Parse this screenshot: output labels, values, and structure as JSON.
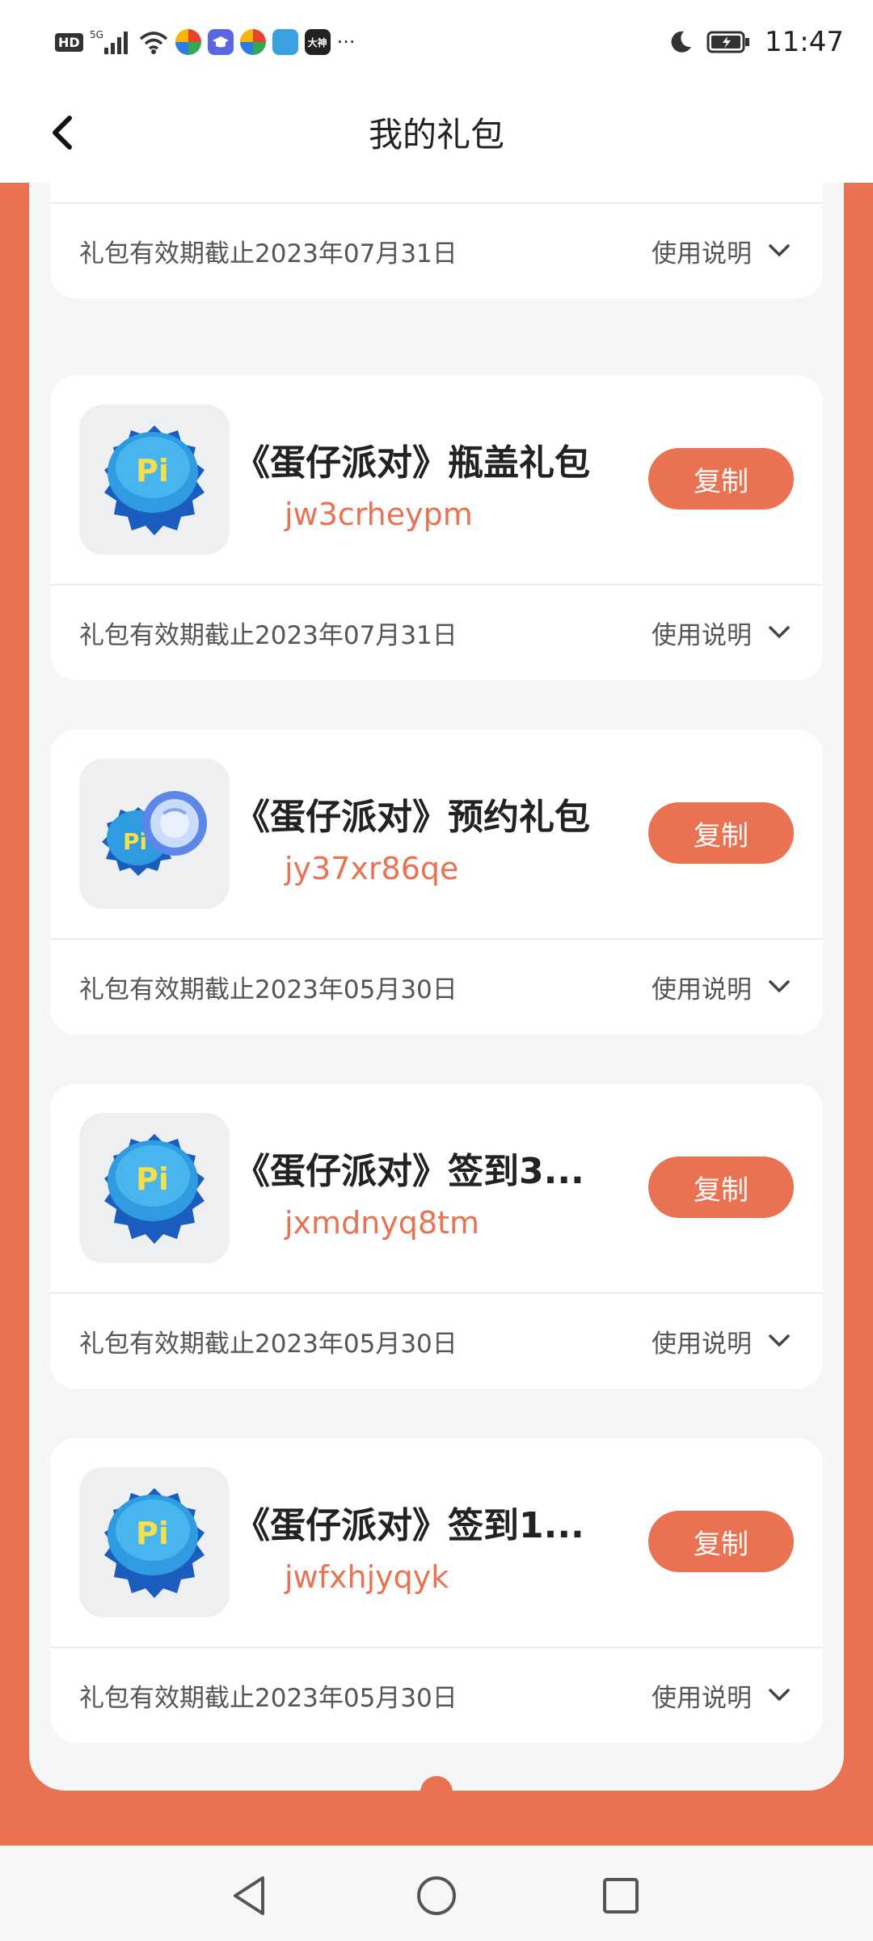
{
  "status_bar": {
    "time": "11:47",
    "hd": "HD",
    "network": "5G",
    "more": "···",
    "icons": [
      "hd-icon",
      "signal-icon",
      "wifi-icon",
      "app-icon-1",
      "app-icon-2",
      "app-icon-3",
      "app-icon-4",
      "app-icon-5",
      "more-icon",
      "moon-icon",
      "battery-icon"
    ]
  },
  "header": {
    "title": "我的礼包"
  },
  "first_partial": {
    "expiry": "礼包有效期截止2023年07月31日",
    "usage": "使用说明"
  },
  "gifts": [
    {
      "name": "《蛋仔派对》瓶盖礼包",
      "code": "jw3crheypm",
      "copy": "复制",
      "expiry": "礼包有效期截止2023年07月31日",
      "usage": "使用说明"
    },
    {
      "name": "《蛋仔派对》预约礼包",
      "code": "jy37xr86qe",
      "copy": "复制",
      "expiry": "礼包有效期截止2023年05月30日",
      "usage": "使用说明"
    },
    {
      "name": "《蛋仔派对》签到3...",
      "code": "jxmdnyq8tm",
      "copy": "复制",
      "expiry": "礼包有效期截止2023年05月30日",
      "usage": "使用说明"
    },
    {
      "name": "《蛋仔派对》签到1...",
      "code": "jwfxhjyqyk",
      "copy": "复制",
      "expiry": "礼包有效期截止2023年05月30日",
      "usage": "使用说明"
    }
  ],
  "colors": {
    "accent": "#e97252",
    "card": "#ffffff",
    "panel": "#f6f6f7"
  }
}
